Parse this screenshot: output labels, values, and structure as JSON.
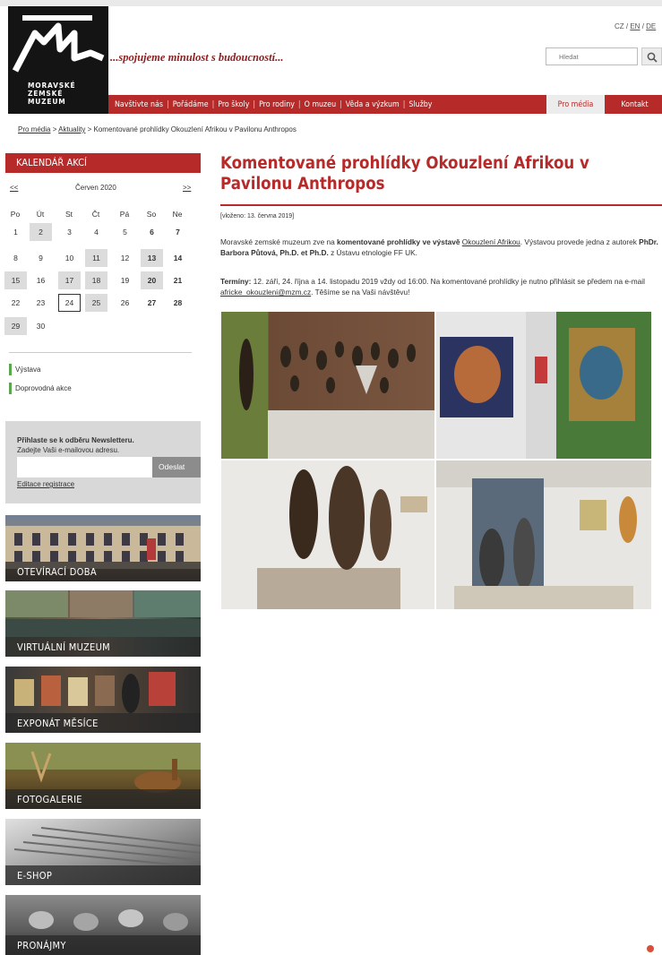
{
  "header": {
    "logo_lines": [
      "MORAVSKÉ",
      "ZEMSKÉ",
      "MUZEUM"
    ],
    "tagline": "...spojujeme minulost s budoucností...",
    "lang_cz": "CZ",
    "lang_sep1": " / ",
    "lang_en": "EN",
    "lang_sep2": " / ",
    "lang_de": "DE",
    "search_placeholder": "Hledat"
  },
  "nav": {
    "items": [
      "Navštivte nás",
      "Pořádáme",
      "Pro školy",
      "Pro rodiny",
      "O muzeu",
      "Věda a výzkum",
      "Služby"
    ],
    "separator": "|",
    "active": "Pro média",
    "contact": "Kontakt"
  },
  "breadcrumb": {
    "level1": "Pro média",
    "sep": " > ",
    "level2": "Aktuality",
    "current": "Komentované prohlídky Okouzlení Afrikou v Pavilonu Anthropos"
  },
  "calendar": {
    "heading": "KALENDÁŘ AKCÍ",
    "prev": "<<",
    "month": "Červen 2020",
    "next": ">>",
    "weekdays": [
      "Po",
      "Út",
      "St",
      "Čt",
      "Pá",
      "So",
      "Ne"
    ],
    "weeks": [
      [
        "1",
        "2",
        "3",
        "4",
        "5",
        "6",
        "7"
      ],
      [
        "8",
        "9",
        "10",
        "11",
        "12",
        "13",
        "14"
      ],
      [
        "15",
        "16",
        "17",
        "18",
        "19",
        "20",
        "21"
      ],
      [
        "22",
        "23",
        "24",
        "25",
        "26",
        "27",
        "28"
      ],
      [
        "29",
        "30",
        "",
        "",
        "",
        "",
        ""
      ]
    ],
    "legend": [
      "Výstava",
      "Doprovodná akce"
    ],
    "legend_color": "#5aa84b"
  },
  "newsletter": {
    "title": "Přihlaste se k odběru Newsletteru.",
    "subtitle": "Zadejte Vaši e-mailovou adresu.",
    "button": "Odeslat",
    "edit_link": "Editace registrace"
  },
  "tiles": [
    "OTEVÍRACÍ DOBA",
    "VIRTUÁLNÍ MUZEUM",
    "EXPONÁT MĚSÍCE",
    "FOTOGALERIE",
    "E-SHOP",
    "PRONÁJMY"
  ],
  "article": {
    "title": "Komentované prohlídky Okouzlení Afrikou v Pavilonu Anthropos",
    "date": "[vloženo: 13. června 2019]",
    "p1_a": "Moravské zemské muzeum zve na ",
    "p1_b": "komentované prohlídky ve výstavě ",
    "p1_link": "Okouzlení Afrikou",
    "p1_c": ". Výstavou provede jedna z autorek ",
    "p1_d": "PhDr. Barbora Půtová, Ph.D. et Ph.D.",
    "p1_e": " z Ústavu etnologie FF UK.",
    "p2_a": "Termíny:",
    "p2_b": " 12. září, 24. října a 14. listopadu 2019 vždy od 16:00. Na komentované prohlídky je nutno přihlásit se předem na e-mail ",
    "p2_link": "africke_okouzleni@mzm.cz",
    "p2_c": ". Těšíme se na Vaši návštěvu!"
  },
  "colors": {
    "brand_red": "#b72a2a",
    "tagline_red": "#8b1e1e"
  }
}
